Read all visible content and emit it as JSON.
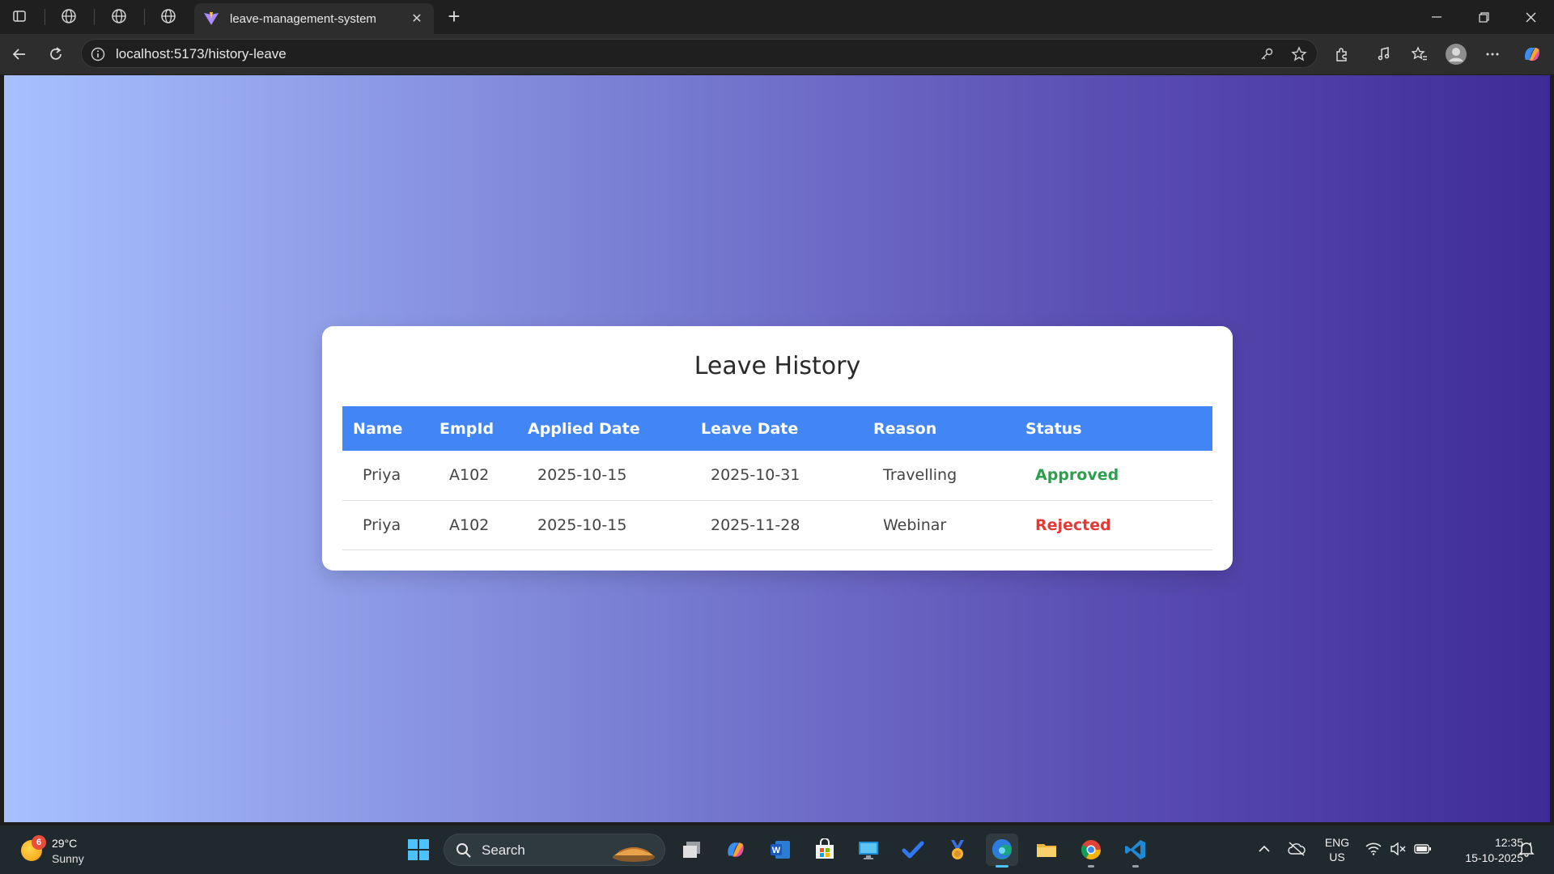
{
  "browser": {
    "tab_title": "leave-management-system",
    "new_tab_symbol": "+",
    "close_tab_symbol": "✕",
    "url": "localhost:5173/history-leave",
    "icons": [
      "sidebar-icon",
      "globe-icon",
      "globe-icon",
      "globe-icon",
      "vite-icon",
      "back-icon",
      "refresh-icon",
      "info-icon",
      "key-icon",
      "star-icon",
      "extensions-icon",
      "media-icon",
      "favorites-icon",
      "profile-icon",
      "more-icon",
      "copilot-icon"
    ]
  },
  "page": {
    "title": "Leave History",
    "table": {
      "headers": [
        "Name",
        "EmpId",
        "Applied Date",
        "Leave Date",
        "Reason",
        "Status"
      ],
      "rows": [
        {
          "name": "Priya",
          "emp_id": "A102",
          "applied_date": "2025-10-15",
          "leave_date": "2025-10-31",
          "reason": "Travelling",
          "status": "Approved"
        },
        {
          "name": "Priya",
          "emp_id": "A102",
          "applied_date": "2025-10-15",
          "leave_date": "2025-11-28",
          "reason": "Webinar",
          "status": "Rejected"
        }
      ]
    },
    "colors": {
      "header_bg": "#4285f4",
      "approved": "#2e9e4f",
      "rejected": "#e53935",
      "gradient_start": "#a8c0ff",
      "gradient_end": "#3f2b96"
    }
  },
  "taskbar": {
    "weather": {
      "badge": "6",
      "temp": "29°C",
      "condition": "Sunny"
    },
    "search_label": "Search",
    "language": {
      "line1": "ENG",
      "line2": "US"
    },
    "clock": {
      "time": "12:35",
      "date": "15-10-2025"
    },
    "apps": [
      "start-icon",
      "task-view-icon",
      "copilot-app-icon",
      "word-icon",
      "store-icon",
      "remote-desktop-icon",
      "todo-icon",
      "medal-icon",
      "edge-icon",
      "file-explorer-icon",
      "chrome-icon",
      "vscode-icon"
    ]
  }
}
